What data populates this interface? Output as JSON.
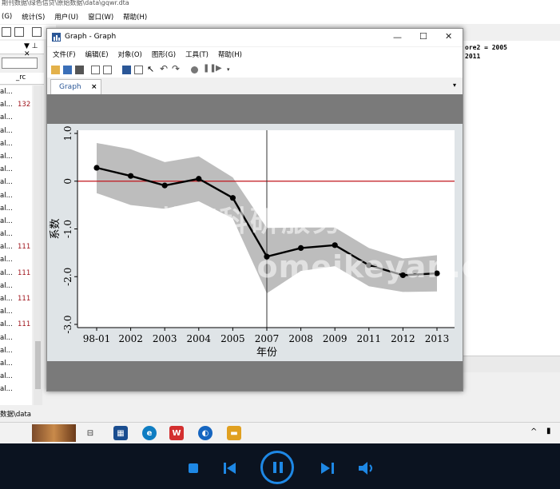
{
  "background": {
    "title": "期刊数据\\绿色信贷\\原始数据\\data\\gqwr.dta",
    "menu": [
      "(G)",
      "统计(S)",
      "用户(U)",
      "窗口(W)",
      "帮助(H)"
    ],
    "var_colhead": "_rc",
    "var_rows": [
      {
        "name": "al...",
        "rc": ""
      },
      {
        "name": "al...",
        "rc": "132"
      },
      {
        "name": "al...",
        "rc": ""
      },
      {
        "name": "al...",
        "rc": ""
      },
      {
        "name": "al...",
        "rc": ""
      },
      {
        "name": "al...",
        "rc": ""
      },
      {
        "name": "al...",
        "rc": ""
      },
      {
        "name": "al...",
        "rc": ""
      },
      {
        "name": "al...",
        "rc": ""
      },
      {
        "name": "al...",
        "rc": ""
      },
      {
        "name": "al...",
        "rc": ""
      },
      {
        "name": "al...",
        "rc": ""
      },
      {
        "name": "al...",
        "rc": "111"
      },
      {
        "name": "al...",
        "rc": ""
      },
      {
        "name": "al...",
        "rc": "111"
      },
      {
        "name": "al...",
        "rc": ""
      },
      {
        "name": "al...",
        "rc": "111"
      },
      {
        "name": "al...",
        "rc": ""
      },
      {
        "name": "al...",
        "rc": "111"
      },
      {
        "name": "al...",
        "rc": ""
      },
      {
        "name": "al...",
        "rc": ""
      },
      {
        "name": "al...",
        "rc": ""
      },
      {
        "name": "al...",
        "rc": ""
      },
      {
        "name": "al...",
        "rc": ""
      }
    ],
    "output_lines": [
      "ore2 = 2005",
      "2011"
    ],
    "status": "数据\\data"
  },
  "graph_window": {
    "title": "Graph - Graph",
    "menu": [
      "文件(F)",
      "编辑(E)",
      "对象(O)",
      "图形(G)",
      "工具(T)",
      "帮助(H)"
    ],
    "tab": "Graph",
    "tab_close": "×"
  },
  "watermark": {
    "line1": "草莓科研服务网",
    "line2": "www.caomeikeyan.com"
  },
  "chart_data": {
    "type": "line",
    "xlabel": "年份",
    "ylabel": "系数",
    "categories": [
      "98-01",
      "2002",
      "2003",
      "2004",
      "2005",
      "2007",
      "2008",
      "2009",
      "2011",
      "2012",
      "2013"
    ],
    "series": [
      {
        "values": [
          0.28,
          0.11,
          -0.09,
          0.05,
          -0.35,
          -1.58,
          -1.4,
          -1.34,
          -1.76,
          -1.97,
          -1.93
        ]
      }
    ],
    "ci_upper": [
      0.8,
      0.67,
      0.4,
      0.52,
      0.08,
      -0.98,
      -0.97,
      -0.97,
      -1.4,
      -1.62,
      -1.55
    ],
    "ci_lower": [
      -0.25,
      -0.5,
      -0.58,
      -0.42,
      -0.78,
      -2.35,
      -1.88,
      -1.78,
      -2.2,
      -2.32,
      -2.31
    ],
    "y_ticks": [
      "1.0",
      "0",
      "-1.0",
      "-2.0",
      "-3.0"
    ],
    "ylim": [
      -3.0,
      1.0
    ],
    "reference_line_y": 0,
    "reference_line_x": "2007",
    "colors": {
      "line": "#000000",
      "band": "#bdbdbd",
      "ref_h": "#c0141b",
      "ref_v": "#333333",
      "plot_bg": "#ffffff",
      "outer_bg": "#dfe4e7"
    }
  },
  "taskbar": {
    "time_icons": [
      "^"
    ]
  },
  "player": {
    "controls": [
      "stop",
      "prev",
      "pause",
      "next",
      "volume"
    ]
  }
}
